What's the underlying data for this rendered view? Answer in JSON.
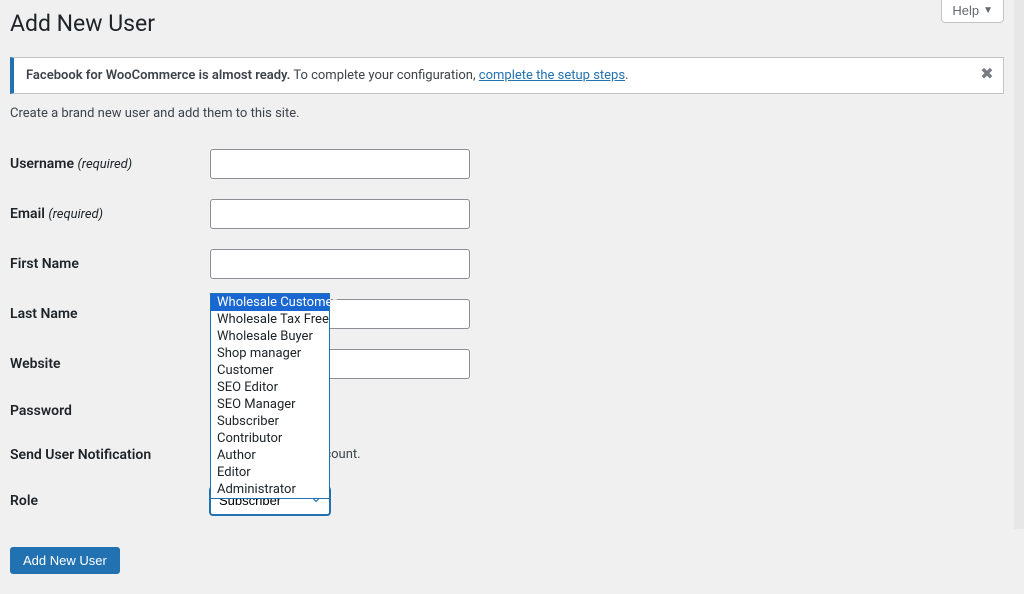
{
  "header": {
    "help_label": "Help"
  },
  "page": {
    "title": "Add New User",
    "intro": "Create a brand new user and add them to this site."
  },
  "notice": {
    "strong": "Facebook for WooCommerce is almost ready.",
    "tail": " To complete your configuration, ",
    "link": "complete the setup steps",
    "period": "."
  },
  "form": {
    "username": {
      "label": "Username",
      "required": "(required)",
      "value": ""
    },
    "email": {
      "label": "Email",
      "required": "(required)",
      "value": ""
    },
    "first_name": {
      "label": "First Name",
      "value": ""
    },
    "last_name": {
      "label": "Last Name",
      "value": ""
    },
    "website": {
      "label": "Website",
      "value": ""
    },
    "password": {
      "label": "Password"
    },
    "notification": {
      "label": "Send User Notification",
      "tail_text": "email about their account."
    },
    "role": {
      "label": "Role",
      "selected": "Subscriber",
      "options": [
        "Wholesale Customer",
        "Wholesale Tax Free",
        "Wholesale Buyer",
        "Shop manager",
        "Customer",
        "SEO Editor",
        "SEO Manager",
        "Subscriber",
        "Contributor",
        "Author",
        "Editor",
        "Administrator"
      ],
      "highlighted_index": 0
    },
    "submit_label": "Add New User"
  }
}
